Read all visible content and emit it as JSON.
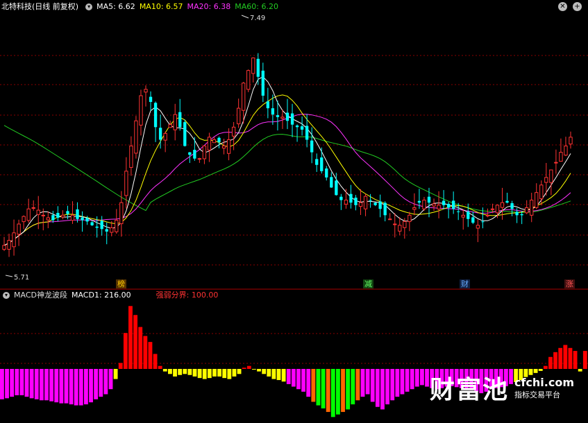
{
  "header": {
    "stock_name": "北特科技",
    "mode": "(日线 前复权)",
    "ma": [
      {
        "label": "MA5: 6.62",
        "color": "#ffffff"
      },
      {
        "label": "MA10: 6.57",
        "color": "#ffff00"
      },
      {
        "label": "MA20: 6.38",
        "color": "#ff33ff"
      },
      {
        "label": "MA60: 6.20",
        "color": "#22cc22"
      }
    ]
  },
  "indicator": {
    "name": "MACD神龙波段",
    "macd1": "MACD1: 216.00",
    "strength": "强弱分界: 100.00"
  },
  "price_labels": {
    "high": "7.49",
    "low": "5.71"
  },
  "markers": [
    {
      "text": "榜",
      "color": "#ffcc00",
      "bg": "#553300"
    },
    {
      "text": "减",
      "color": "#66ff66",
      "bg": "#114411"
    },
    {
      "text": "财",
      "color": "#66aaff",
      "bg": "#112244"
    },
    {
      "text": "涨",
      "color": "#ff5555",
      "bg": "#441111"
    }
  ],
  "watermark": {
    "logo": "财富池",
    "site": "cfchi.com",
    "sub": "指标交易平台"
  },
  "colors": {
    "up": "#ff3333",
    "down": "#00ffff",
    "grid": "#8b0000",
    "ma5": "#ffffff",
    "ma10": "#ffff00",
    "ma20": "#ff33ff",
    "ma60": "#22cc22",
    "hist": [
      "#ff00ff",
      "#ffff00",
      "#ff0000",
      "#ff6600",
      "#00ff00"
    ]
  },
  "chart_data": {
    "type": "candlestick",
    "price_range": [
      5.55,
      7.6
    ],
    "macd_range": [
      -100,
      110
    ],
    "closes": [
      5.76,
      5.8,
      5.86,
      5.93,
      5.99,
      6.05,
      6.06,
      6.04,
      6.0,
      5.98,
      5.96,
      5.98,
      6.0,
      6.01,
      6.0,
      5.97,
      5.96,
      5.95,
      5.92,
      5.9,
      5.89,
      5.87,
      5.9,
      5.96,
      6.1,
      6.35,
      6.55,
      6.75,
      6.95,
      7.0,
      6.9,
      6.7,
      6.6,
      6.65,
      6.72,
      6.8,
      6.7,
      6.55,
      6.48,
      6.45,
      6.45,
      6.55,
      6.62,
      6.6,
      6.58,
      6.55,
      6.6,
      6.7,
      6.85,
      7.05,
      7.15,
      7.25,
      7.1,
      6.95,
      6.85,
      6.8,
      6.78,
      6.78,
      6.75,
      6.72,
      6.7,
      6.68,
      6.6,
      6.5,
      6.4,
      6.35,
      6.3,
      6.22,
      6.16,
      6.12,
      6.12,
      6.1,
      6.08,
      6.1,
      6.15,
      6.12,
      6.08,
      6.05,
      6.0,
      5.97,
      5.93,
      5.92,
      5.95,
      6.0,
      6.06,
      6.1,
      6.12,
      6.1,
      6.09,
      6.08,
      6.08,
      6.06,
      6.05,
      6.03,
      6.0,
      5.97,
      5.94,
      5.92,
      5.95,
      6.0,
      6.05,
      6.08,
      6.1,
      6.1,
      6.05,
      6.0,
      6.0,
      6.06,
      6.12,
      6.18,
      6.24,
      6.3,
      6.36,
      6.42,
      6.5,
      6.55,
      6.62
    ],
    "macd": [
      -60,
      -58,
      -55,
      -52,
      -52,
      -55,
      -58,
      -60,
      -62,
      -62,
      -64,
      -66,
      -68,
      -68,
      -70,
      -72,
      -72,
      -70,
      -66,
      -60,
      -55,
      -50,
      -40,
      -20,
      10,
      60,
      105,
      90,
      70,
      55,
      45,
      25,
      5,
      -5,
      -10,
      -15,
      -12,
      -10,
      -12,
      -15,
      -18,
      -20,
      -18,
      -15,
      -15,
      -18,
      -20,
      -15,
      -10,
      2,
      5,
      0,
      -5,
      -10,
      -15,
      -20,
      -22,
      -25,
      -30,
      -35,
      -40,
      -45,
      -55,
      -65,
      -72,
      -78,
      -85,
      -95,
      -90,
      -85,
      -80,
      -70,
      -62,
      -55,
      -50,
      -65,
      -75,
      -80,
      -70,
      -62,
      -55,
      -50,
      -45,
      -40,
      -35,
      -32,
      -35,
      -38,
      -40,
      -38,
      -35,
      -34,
      -36,
      -38,
      -40,
      -42,
      -45,
      -48,
      -45,
      -40,
      -38,
      -36,
      -34,
      -30,
      -26,
      -22,
      -16,
      -12,
      -8,
      -4,
      5,
      20,
      28,
      35,
      40,
      35,
      30,
      -5,
      30
    ],
    "last_value_labels": {
      "MA5": 6.62,
      "MA10": 6.57,
      "MA20": 6.38,
      "MA60": 6.2,
      "MACD1": 216.0,
      "强弱分界": 100.0
    }
  }
}
